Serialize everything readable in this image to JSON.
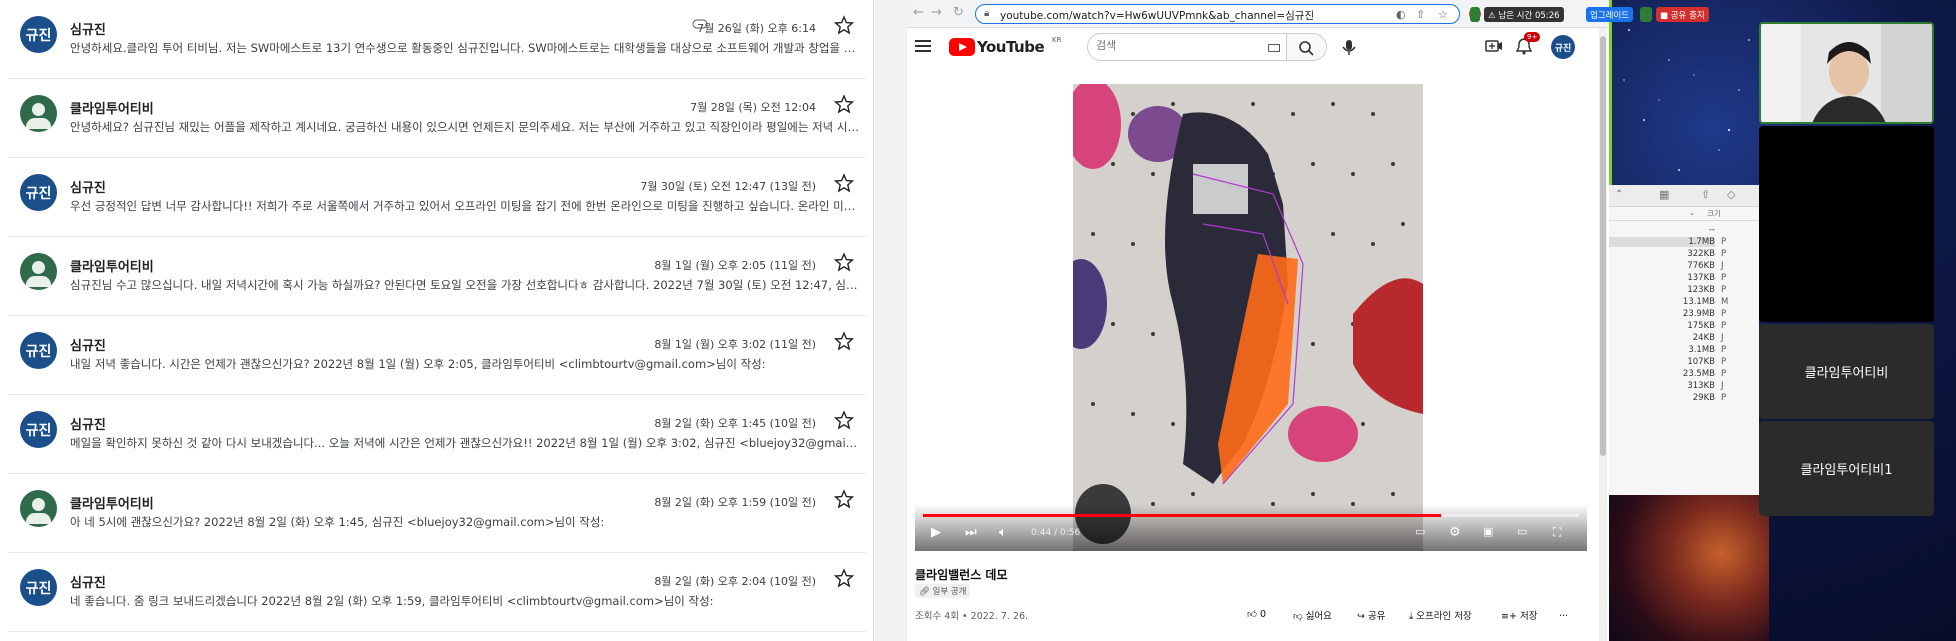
{
  "emails": [
    {
      "sender": "심규진",
      "avatar": "규진",
      "avatar_type": "initials",
      "date": "7월 26일 (화) 오후 6:14",
      "has_attachment": true,
      "snippet": "안녕하세요.클라임 투어 티비님. 저는 SW마에스트로 13기 연수생으로 활동중인 심규진입니다. SW마에스트로는 대학생들을 대상으로 소프트웨어 개발과 창업을 지원..."
    },
    {
      "sender": "클라임투어티비",
      "avatar": "",
      "avatar_type": "person",
      "date": "7월 28일 (목) 오전 12:04",
      "has_attachment": false,
      "snippet": "안녕하세요? 심규진님 재밌는 어플을 제작하고 계시네요. 궁금하신 내용이 있으시면 언제든지 문의주세요. 저는 부산에 거주하고 있고 직장인이라 평일에는 저녁 시간만 ..."
    },
    {
      "sender": "심규진",
      "avatar": "규진",
      "avatar_type": "initials",
      "date": "7월 30일 (토) 오전 12:47 (13일 전)",
      "has_attachment": false,
      "snippet": "우선 긍정적인 답변 너무 감사합니다!! 저희가 주로 서울쪽에서 거주하고 있어서 오프라인 미팅을 잡기 전에 한번 온라인으로 미팅을 진행하고 싶습니다. 온라인 미팅에서..."
    },
    {
      "sender": "클라임투어티비",
      "avatar": "",
      "avatar_type": "person",
      "date": "8월 1일 (월) 오후 2:05 (11일 전)",
      "has_attachment": false,
      "snippet": "심규진님 수고 많으십니다. 내일 저녁시간에 혹시 가능 하실까요? 안된다면 토요일 오전을 가장 선호합니다ㅎ 감사합니다. 2022년 7월 30일 (토) 오전 12:47, 심규진 <..."
    },
    {
      "sender": "심규진",
      "avatar": "규진",
      "avatar_type": "initials",
      "date": "8월 1일 (월) 오후 3:02 (11일 전)",
      "has_attachment": false,
      "snippet": "내일 저녁 좋습니다. 시간은 언제가 괜찮으신가요? 2022년 8월 1일 (월) 오후 2:05, 클라임투어티비 <climbtourtv@gmail.com>님이 작성:"
    },
    {
      "sender": "심규진",
      "avatar": "규진",
      "avatar_type": "initials",
      "date": "8월 2일 (화) 오후 1:45 (10일 전)",
      "has_attachment": false,
      "snippet": "메일을 확인하지 못하신 것 같아 다시 보내겠습니다... 오늘 저녁에 시간은 언제가 괜찮으신가요!! 2022년 8월 1일 (월) 오후 3:02, 심규진 <bluejoy32@gmail.com>님..."
    },
    {
      "sender": "클라임투어티비",
      "avatar": "",
      "avatar_type": "person",
      "date": "8월 2일 (화) 오후 1:59 (10일 전)",
      "has_attachment": false,
      "snippet": "아 네 5시에 괜찮으신가요? 2022년 8월 2일 (화) 오후 1:45, 심규진 <bluejoy32@gmail.com>님이 작성:"
    },
    {
      "sender": "심규진",
      "avatar": "규진",
      "avatar_type": "initials",
      "date": "8월 2일 (화) 오후 2:04 (10일 전)",
      "has_attachment": false,
      "snippet": "네 좋습니다. 줌 링크 보내드리겠습니다 2022년 8월 2일 (화) 오후 1:59, 클라임투어티비 <climbtourtv@gmail.com>님이 작성:"
    }
  ],
  "browser": {
    "url": "youtube.com/watch?v=Hw6wUUVPmnk&ab_channel=심규진"
  },
  "youtube": {
    "wordmark": "YouTube",
    "region": "KR",
    "search_placeholder": "검색",
    "notif_count": "9+",
    "avatar": "규진",
    "time": "0:44 / 0:56",
    "progress": 0.79,
    "title": "클라임밸런스 데모",
    "visibility": "일부 공개",
    "views": "조회수 4회 • 2022. 7. 26.",
    "like_count": "0",
    "dislike_label": "싫어요",
    "share_label": "공유",
    "offline_label": "오프라인 저장",
    "save_label": "저장",
    "more_label": "..."
  },
  "sysbar": {
    "time_left_label": "남은 시간",
    "time_left": "05:26",
    "upgrade_label": "업그레이드",
    "stop_share_label": "공유 중지"
  },
  "finder": {
    "col_size": "크기",
    "rows": [
      {
        "size": "--",
        "kind": ""
      },
      {
        "size": "1.7MB",
        "kind": "P"
      },
      {
        "size": "322KB",
        "kind": "P"
      },
      {
        "size": "776KB",
        "kind": "J"
      },
      {
        "size": "137KB",
        "kind": "P"
      },
      {
        "size": "123KB",
        "kind": "P"
      },
      {
        "size": "13.1MB",
        "kind": "M"
      },
      {
        "size": "23.9MB",
        "kind": "P"
      },
      {
        "size": "175KB",
        "kind": "P"
      },
      {
        "size": "24KB",
        "kind": "J"
      },
      {
        "size": "3.1MB",
        "kind": "P"
      },
      {
        "size": "107KB",
        "kind": "P"
      },
      {
        "size": "23.5MB",
        "kind": "P"
      },
      {
        "size": "313KB",
        "kind": "J"
      },
      {
        "size": "29KB",
        "kind": "P"
      }
    ]
  },
  "meeting": {
    "participant1": "클라임투어티비",
    "participant2": "클라임투어티비1"
  }
}
